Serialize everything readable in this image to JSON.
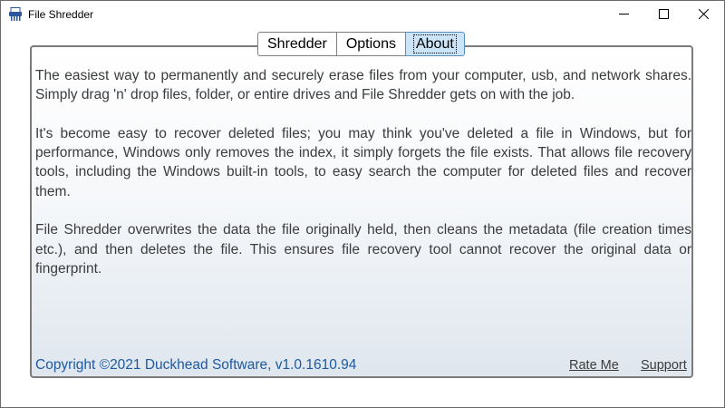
{
  "window": {
    "title": "File Shredder",
    "controls": {
      "minimize_icon": "minimize-icon",
      "maximize_icon": "maximize-icon",
      "close_icon": "close-icon"
    }
  },
  "app_icon": "shredder-icon",
  "tabs": [
    {
      "label": "Shredder",
      "selected": false
    },
    {
      "label": "Options",
      "selected": false
    },
    {
      "label": "About",
      "selected": true
    }
  ],
  "about": {
    "paragraphs": [
      "The easiest way to permanently and securely erase files from your computer, usb, and network shares. Simply drag 'n' drop files, folder, or entire drives and File Shredder gets on with the job.",
      "It's become easy to recover deleted files; you may think you've deleted a file in Windows, but for performance, Windows only removes the index, it simply forgets the file exists. That allows file recovery tools, including the Windows built-in tools, to easy search the computer for deleted files and recover them.",
      "File Shredder overwrites the data the file originally held, then cleans the metadata (file creation times etc.), and then deletes the file. This ensures file recovery tool cannot recover the original data or fingerprint."
    ]
  },
  "footer": {
    "copyright": "Copyright ©2021 Duckhead Software, v1.0.1610.94",
    "rate_link": "Rate Me",
    "support_link": "Support"
  },
  "colors": {
    "selected_tab": "#cce4f7",
    "copyright_text": "#1e5aa0",
    "body_text": "#3c3c3c"
  }
}
